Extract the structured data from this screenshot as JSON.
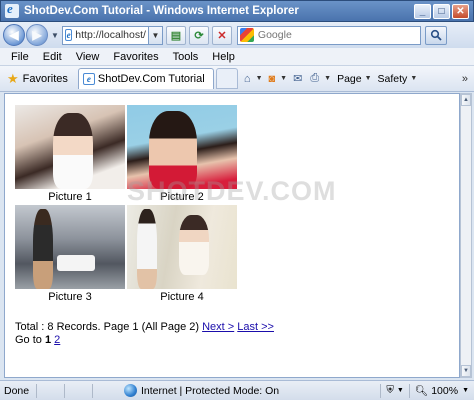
{
  "window": {
    "title": "ShotDev.Com Tutorial - Windows Internet Explorer",
    "controls": {
      "minimize": "_",
      "maximize": "□",
      "close": "✕"
    }
  },
  "address_bar": {
    "url": "http://localhost/",
    "search_placeholder": "Google",
    "search_engine_icon": "google-icon"
  },
  "menu": {
    "items": [
      "File",
      "Edit",
      "View",
      "Favorites",
      "Tools",
      "Help"
    ]
  },
  "favorites_bar": {
    "favorites_label": "Favorites",
    "tab_label": "ShotDev.Com Tutorial",
    "commands": [
      "Page",
      "Safety"
    ],
    "more": "»"
  },
  "content": {
    "pictures": [
      {
        "caption": "Picture 1"
      },
      {
        "caption": "Picture 2"
      },
      {
        "caption": "Picture 3"
      },
      {
        "caption": "Picture 4"
      }
    ],
    "watermark": "SHOTDEV.COM",
    "records_text": "Total : 8 Records. Page 1 (All Page 2)",
    "next_link": "Next >",
    "last_link": "Last >>",
    "goto_label": "Go to",
    "current_page": "1",
    "page_link_2": "2"
  },
  "status": {
    "left": "Done",
    "zone": "Internet | Protected Mode: On",
    "zoom": "100%"
  }
}
